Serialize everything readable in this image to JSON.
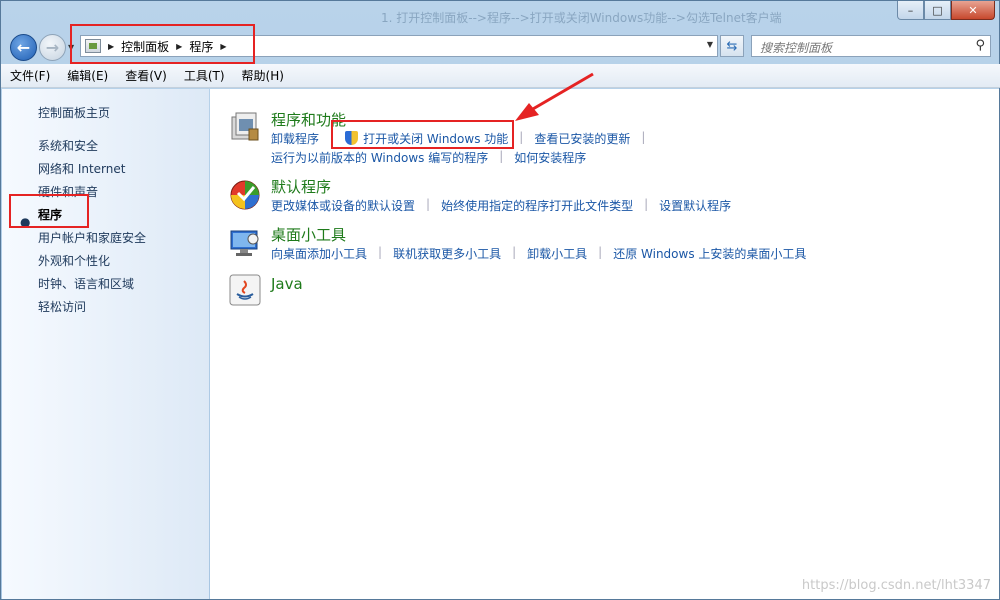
{
  "window": {
    "faded_title": "1. 打开控制面板-->程序-->打开或关闭Windows功能-->勾选Telnet客户端"
  },
  "navigation": {
    "breadcrumb": [
      "控制面板",
      "程序"
    ],
    "search_placeholder": "搜索控制面板"
  },
  "menu": [
    "文件(F)",
    "编辑(E)",
    "查看(V)",
    "工具(T)",
    "帮助(H)"
  ],
  "sidebar": {
    "items": [
      {
        "label": "控制面板主页",
        "current": false
      },
      {
        "label": "系统和安全",
        "current": false
      },
      {
        "label": "网络和 Internet",
        "current": false
      },
      {
        "label": "硬件和声音",
        "current": false
      },
      {
        "label": "程序",
        "current": true
      },
      {
        "label": "用户帐户和家庭安全",
        "current": false
      },
      {
        "label": "外观和个性化",
        "current": false
      },
      {
        "label": "时钟、语言和区域",
        "current": false
      },
      {
        "label": "轻松访问",
        "current": false
      }
    ]
  },
  "categories": [
    {
      "title": "程序和功能",
      "icon": "programs-features-icon",
      "links": [
        [
          "卸载程序",
          "打开或关闭 Windows 功能",
          "查看已安装的更新"
        ],
        [
          "运行为以前版本的 Windows 编写的程序",
          "如何安装程序"
        ]
      ]
    },
    {
      "title": "默认程序",
      "icon": "default-programs-icon",
      "links": [
        [
          "更改媒体或设备的默认设置",
          "始终使用指定的程序打开此文件类型",
          "设置默认程序"
        ]
      ]
    },
    {
      "title": "桌面小工具",
      "icon": "desktop-gadgets-icon",
      "links": [
        [
          "向桌面添加小工具",
          "联机获取更多小工具",
          "卸载小工具",
          "还原 Windows 上安装的桌面小工具"
        ]
      ]
    },
    {
      "title": "Java",
      "icon": "java-icon",
      "links": []
    }
  ],
  "watermark": "https://blog.csdn.net/lht3347",
  "colors": {
    "annotation_red": "#e52323",
    "link_blue": "#1b57a6",
    "category_green": "#1e7a1a"
  }
}
